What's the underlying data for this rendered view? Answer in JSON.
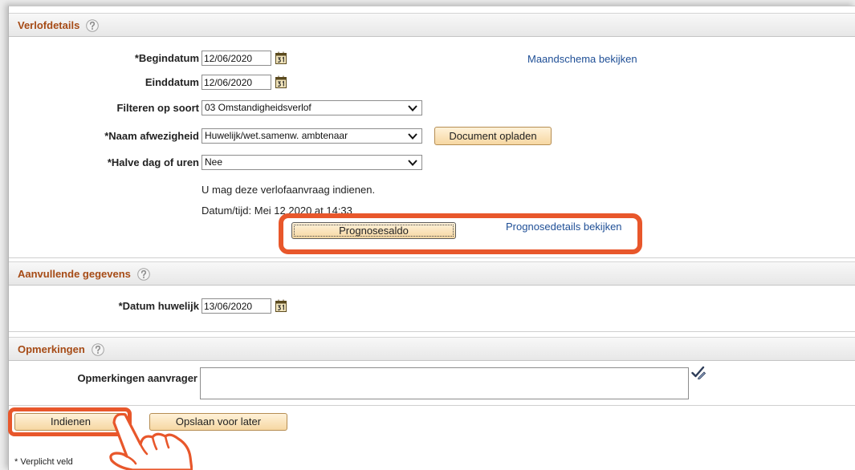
{
  "verlofdetails": {
    "title": "Verlofdetails",
    "begindatum": {
      "label": "*Begindatum",
      "value": "12/06/2020"
    },
    "einddatum": {
      "label": "Einddatum",
      "value": "12/06/2020"
    },
    "filteren_op_soort": {
      "label": "Filteren op soort",
      "value": "03 Omstandigheidsverlof"
    },
    "naam_afwezigheid": {
      "label": "*Naam afwezigheid",
      "value": "Huwelijk/wet.samenw. ambtenaar"
    },
    "halve_dag_of_uren": {
      "label": "*Halve dag of uren",
      "value": "Nee"
    },
    "maandschema_link": "Maandschema bekijken",
    "document_opladen_button": "Document opladen",
    "status_message": "U mag deze verlofaanvraag indienen.",
    "datum_tijd": "Datum/tijd: Mei 12 2020 at 14:33",
    "prognosesaldo_button": "Prognosesaldo",
    "prognosedetails_link": "Prognosedetails bekijken"
  },
  "aanvullende_gegevens": {
    "title": "Aanvullende gegevens",
    "datum_huwelijk": {
      "label": "*Datum huwelijk",
      "value": "13/06/2020"
    }
  },
  "opmerkingen": {
    "title": "Opmerkingen",
    "opmerkingen_aanvrager": {
      "label": "Opmerkingen aanvrager"
    }
  },
  "actions": {
    "indienen": "Indienen",
    "opslaan_voor_later": "Opslaan voor later"
  },
  "footer": {
    "verplicht_veld": "* Verplicht veld"
  },
  "icons": {
    "help": "help-icon",
    "calendar": "calendar-icon",
    "dropdown": "chevron-down-icon",
    "spellcheck": "spellcheck-icon",
    "pointer": "hand-pointer-icon"
  },
  "colors": {
    "section_title": "#a64b16",
    "link": "#1f4f96",
    "annotation": "#e8572b",
    "button": "#f6d7a2"
  }
}
